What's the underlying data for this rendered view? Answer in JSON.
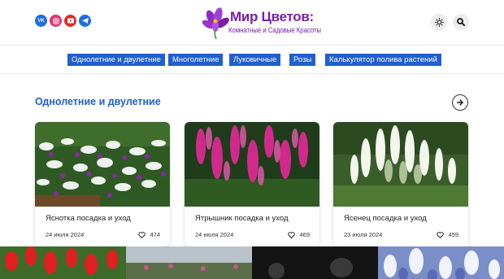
{
  "header": {
    "socials": [
      {
        "icon": "vk-icon",
        "label": "VK"
      },
      {
        "icon": "instagram-icon",
        "label": ""
      },
      {
        "icon": "youtube-icon",
        "label": ""
      },
      {
        "icon": "telegram-icon",
        "label": ""
      }
    ],
    "logo": {
      "title": "Мир Цветов:",
      "subtitle": "Комнатные и Садовые Красоты"
    },
    "theme_icon": "sun-icon",
    "search_icon": "search-icon"
  },
  "nav": {
    "items": [
      "Однолетние и двулетние",
      "Многолетние",
      "Луковичные",
      "Розы",
      "Калькулятор полива растений"
    ]
  },
  "section": {
    "title": "Однолетние и двулетние",
    "next_icon": "arrow-right-icon"
  },
  "cards": [
    {
      "title": "Яснотка посадка и уход",
      "date": "24 июля 2024",
      "likes": "474"
    },
    {
      "title": "Ятрышник посадка и уход",
      "date": "24 июля 2024",
      "likes": "469"
    },
    {
      "title": "Ясенец посадка и уход",
      "date": "23 июля 2024",
      "likes": "459"
    }
  ],
  "colors": {
    "accent": "#1f5fd0",
    "logo": "#7a1fa8",
    "vk": "#1e6fe0",
    "instagram": "#e0336f",
    "youtube": "#e02a2a"
  }
}
